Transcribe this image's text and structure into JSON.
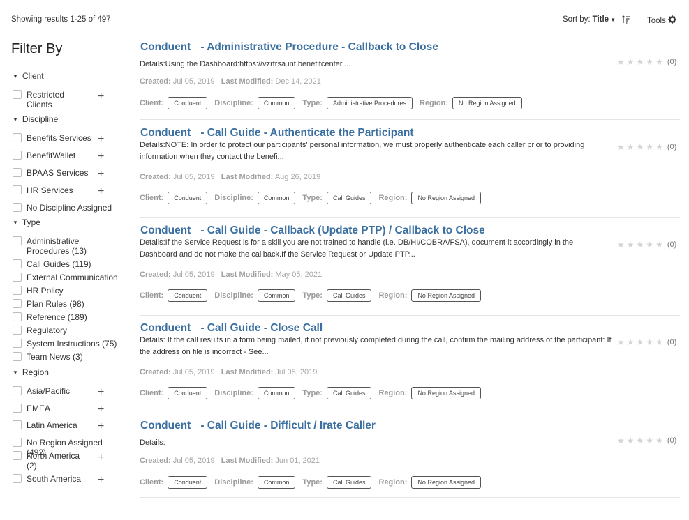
{
  "header": {
    "results_text": "Showing results 1-25 of 497",
    "sort_label": "Sort by:",
    "sort_value": "Title",
    "tools_label": "Tools"
  },
  "sidebar": {
    "title": "Filter By",
    "client": {
      "heading": "Client",
      "items": [
        {
          "label": "Restricted Clients"
        }
      ]
    },
    "discipline": {
      "heading": "Discipline",
      "items": [
        {
          "label": "Benefits Services"
        },
        {
          "label": "BenefitWallet"
        },
        {
          "label": "BPAAS Services"
        },
        {
          "label": "HR Services"
        },
        {
          "label": "No Discipline Assigned"
        }
      ]
    },
    "type": {
      "heading": "Type",
      "items": [
        {
          "label": "Administrative Procedures (13)"
        },
        {
          "label": "Call Guides (119)"
        },
        {
          "label": "External Communication"
        },
        {
          "label": "HR Policy"
        },
        {
          "label": "Plan Rules (98)"
        },
        {
          "label": "Reference (189)"
        },
        {
          "label": "Regulatory"
        },
        {
          "label": "System Instructions (75)"
        },
        {
          "label": "Team News (3)"
        }
      ]
    },
    "region": {
      "heading": "Region",
      "items": [
        {
          "label": "Asia/Pacific"
        },
        {
          "label": "EMEA"
        },
        {
          "label": "Latin America"
        },
        {
          "label": "No Region Assigned (492)"
        },
        {
          "label": "North America (2)"
        },
        {
          "label": "South America"
        }
      ]
    },
    "expand_symbol": "+"
  },
  "labels": {
    "created": "Created:",
    "last_modified": "Last Modified:",
    "client": "Client:",
    "discipline": "Discipline:",
    "type": "Type:",
    "region": "Region:"
  },
  "results": [
    {
      "title_client": "Conduent",
      "title_rest": "- Administrative Procedure - Callback to Close",
      "details": "Details:Using the Dashboard:https://vzrtrsa.int.benefitcenter....",
      "created": "Jul 05, 2019",
      "modified": "Dec 14, 2021",
      "client": "Conduent",
      "discipline": "Common",
      "type": "Administrative Procedures",
      "region": "No Region Assigned",
      "rating_count": "(0)"
    },
    {
      "title_client": "Conduent",
      "title_rest": "- Call Guide - Authenticate the Participant",
      "details": "Details:NOTE: In order to protect our participants' personal information, we must properly authenticate each caller prior to providing information when they contact the benefi...",
      "created": "Jul 05, 2019",
      "modified": "Aug 26, 2019",
      "client": "Conduent",
      "discipline": "Common",
      "type": "Call Guides",
      "region": "No Region Assigned",
      "rating_count": "(0)"
    },
    {
      "title_client": "Conduent",
      "title_rest": "- Call Guide - Callback (Update PTP) / Callback to Close",
      "details": "Details:If the Service Request is for a skill you are not trained to handle (i.e. DB/HI/COBRA/FSA), document it accordingly in the Dashboard and do not make the callback.If the Service Request or Update PTP...",
      "created": "Jul 05, 2019",
      "modified": "May 05, 2021",
      "client": "Conduent",
      "discipline": "Common",
      "type": "Call Guides",
      "region": "No Region Assigned",
      "rating_count": "(0)"
    },
    {
      "title_client": "Conduent",
      "title_rest": "- Call Guide - Close Call",
      "details": "Details: If the call results in a form being mailed, if not previously completed during the call, confirm the mailing address of the participant: If the address on file is incorrect - See...",
      "created": "Jul 05, 2019",
      "modified": "Jul 05, 2019",
      "client": "Conduent",
      "discipline": "Common",
      "type": "Call Guides",
      "region": "No Region Assigned",
      "rating_count": "(0)"
    },
    {
      "title_client": "Conduent",
      "title_rest": "- Call Guide - Difficult / Irate Caller",
      "details": "Details:",
      "created": "Jul 05, 2019",
      "modified": "Jun 01, 2021",
      "client": "Conduent",
      "discipline": "Common",
      "type": "Call Guides",
      "region": "No Region Assigned",
      "rating_count": "(0)"
    }
  ]
}
